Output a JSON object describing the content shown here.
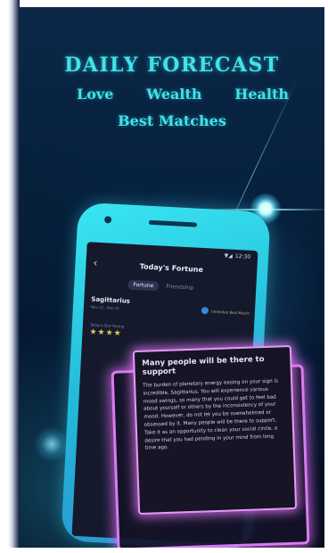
{
  "header": {
    "title": "DAILY FORECAST",
    "categories": [
      "Love",
      "Wealth",
      "Health"
    ],
    "subtitle": "Best Matches"
  },
  "phone": {
    "status_time": "12:30",
    "screen_title": "Today's Fortune",
    "tabs": [
      "Fortune",
      "Friendship"
    ],
    "sign_name": "Sagittarius",
    "sign_date": "Nov 22 - Dec 21",
    "badge_text": "Unlimited Best Match",
    "rating_label": "Today's Star Rating",
    "stars": "★★★★"
  },
  "card": {
    "title": "Many people will be there to support",
    "body": "The burden of planetary energy easing on your sign is incredible, Sagittarius. You will experience various mood swings, so many that you could get to feel bad about yourself or others by the inconsistency of your mood. However, do not let you be overwhelmed or obsessed by it. Many people will be there to support. Take it as an opportunity to clean your social circle, a desire that you had pending in your mind from long time ago."
  },
  "colors": {
    "accent": "#3fe3e8",
    "card_glow": "#e39af5",
    "background": "#04142b"
  }
}
